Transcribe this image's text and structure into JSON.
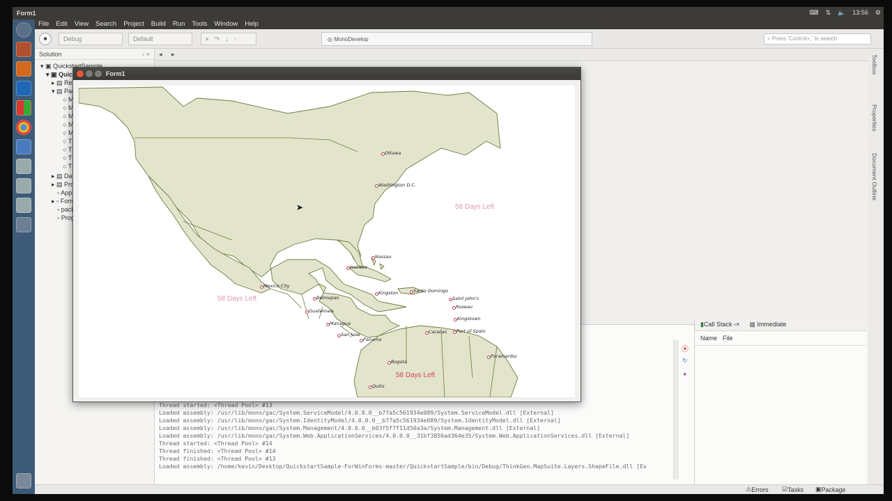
{
  "top_panel": {
    "window_title": "Form1",
    "time": "13:56"
  },
  "menu": [
    "File",
    "Edit",
    "View",
    "Search",
    "Project",
    "Build",
    "Run",
    "Tools",
    "Window",
    "Help"
  ],
  "toolbar": {
    "config": "Debug",
    "platform": "Default",
    "status": "MonoDevelop",
    "search_placeholder": "Press 'Control+,' to search"
  },
  "solution": {
    "title": "Solution",
    "items": [
      "QuickstartSample",
      "Quick",
      "Refe",
      "Pack",
      "Ma",
      "Ma",
      "Ma",
      "Ma",
      "Ma",
      "Th",
      "Th",
      "Th",
      "Th",
      "Data",
      "Prop",
      "App",
      "Form",
      "pack",
      "Prog"
    ]
  },
  "right_strip": [
    "Toolbox",
    "Properties",
    "Document Outline"
  ],
  "form": {
    "title": "Form1"
  },
  "map": {
    "land_color": "#e3e4cc",
    "border_color": "#6f7a3e",
    "city_color": "#b5425a",
    "cities": [
      "Ottawa",
      "Washington D.C.",
      "Nassau",
      "Havana",
      "Mexico City",
      "Belmopan",
      "Kingston",
      "Santo Domingo",
      "Saint John's",
      "Roseau",
      "Kingstown",
      "Port of Spain",
      "Guatemala",
      "Managua",
      "San Jose",
      "Panama",
      "Caracas",
      "Paramaribo",
      "Bogota",
      "Quito"
    ],
    "overlays": [
      "58 Days Left",
      "58 Days Left",
      "58 Days Left"
    ]
  },
  "output_log": [
    "Thread started: <Thread Pool> #13",
    "Loaded assembly: /usr/lib/mono/gac/System.ServiceModel/4.0.0.0__b77a5c561934e089/System.ServiceModel.dll [External]",
    "Loaded assembly: /usr/lib/mono/gac/System.IdentityModel/4.0.0.0__b77a5c561934e089/System.IdentityModel.dll [External]",
    "Loaded assembly: /usr/lib/mono/gac/System.Management/4.0.0.0__b03f5f7f11d50a3a/System.Management.dll [External]",
    "Loaded assembly: /usr/lib/mono/gac/System.Web.ApplicationServices/4.0.0.0__31bf3856ad364e35/System.Web.ApplicationServices.dll [External]",
    "Thread started: <Thread Pool> #14",
    "Thread finished: <Thread Pool> #14",
    "Thread finished: <Thread Pool> #13",
    "Loaded assembly: /home/kevin/Desktop/QuickstartSample-ForWinForms-master/QuickstartSample/bin/Debug/ThinkGeo.MapSuite.Layers.ShapeFile.dll [Ex"
  ],
  "bottom_pad": {
    "tabs": [
      "Call Stack",
      "Immediate"
    ],
    "columns": [
      "Name",
      "File"
    ]
  },
  "statusbar": [
    "Errors",
    "Tasks",
    "Package Console"
  ]
}
